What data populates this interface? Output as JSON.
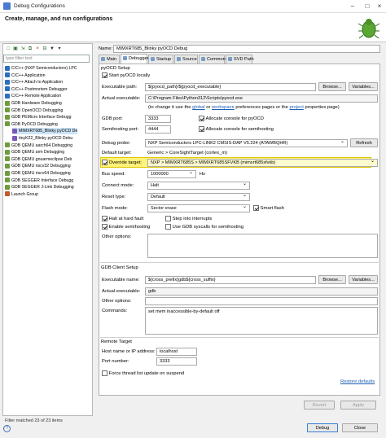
{
  "window": {
    "title": "Debug Configurations"
  },
  "banner": {
    "heading": "Create, manage, and run configurations"
  },
  "left": {
    "filter_placeholder": "type filter text",
    "tree": [
      {
        "label": "C/C++ (NXP Semiconductors) LPC",
        "level": 0,
        "color": "#2a6fbf"
      },
      {
        "label": "C/C++ Application",
        "level": 0,
        "color": "#2a6fbf"
      },
      {
        "label": "C/C++ Attach to Application",
        "level": 0,
        "color": "#2a6fbf"
      },
      {
        "label": "C/C++ Postmortem Debugger",
        "level": 0,
        "color": "#2a6fbf"
      },
      {
        "label": "C/C++ Remote Application",
        "level": 0,
        "color": "#2a6fbf"
      },
      {
        "label": "GDB Hardware Debugging",
        "level": 0,
        "color": "#6d9c3c"
      },
      {
        "label": "GDB OpenOCD Debugging",
        "level": 0,
        "color": "#6d9c3c"
      },
      {
        "label": "GDB PEMicro Interface Debugg",
        "level": 0,
        "color": "#6d9c3c"
      },
      {
        "label": "GDB PyOCD Debugging",
        "level": 0,
        "color": "#6d9c3c"
      },
      {
        "label": "MIMXRT685_Blinky pyOCD De",
        "level": 1,
        "color": "#7a58b8",
        "selected": true
      },
      {
        "label": "tinyK22_Blinky pyOCD Debu",
        "level": 1,
        "color": "#7a58b8"
      },
      {
        "label": "GDB QEMU aarch64 Debugging",
        "level": 0,
        "color": "#6d9c3c"
      },
      {
        "label": "GDB QEMU arm Debugging",
        "level": 0,
        "color": "#6d9c3c"
      },
      {
        "label": "GDB QEMU gnuarmeclipse Deb",
        "level": 0,
        "color": "#6d9c3c"
      },
      {
        "label": "GDB QEMU riscv32 Debugging",
        "level": 0,
        "color": "#6d9c3c"
      },
      {
        "label": "GDB QEMU riscv64 Debugging",
        "level": 0,
        "color": "#6d9c3c"
      },
      {
        "label": "GDB SEGGER Interface Debugg",
        "level": 0,
        "color": "#6d9c3c"
      },
      {
        "label": "GDB SEGGER J-Link Debugging",
        "level": 0,
        "color": "#6d9c3c"
      },
      {
        "label": "Launch Group",
        "level": 0,
        "color": "#c05a2a"
      }
    ],
    "footer": "Filter matched 23 of 23 items"
  },
  "config": {
    "name_label": "Name:",
    "name_value": "MIMXRT685_Blinky pyOCD Debug",
    "tabs": [
      "Main",
      "Debugger",
      "Startup",
      "Source",
      "Common",
      "SVD Path"
    ],
    "active_tab": 1
  },
  "pyocd": {
    "group": "pyOCD Setup",
    "start_locally": "Start pyOCD locally",
    "exe_label": "Executable path:",
    "exe_value": "${pyocd_path}/${pyocd_executable}",
    "actual_exe_label": "Actual executable:",
    "actual_exe_value": "C:\\Program Files\\Python312\\Scripts\\pyocd.exe",
    "change_note_pre": "(to change it use the",
    "global": "global",
    "or": "or",
    "workspace": "workspace",
    "preferences_mid": "preferences pages or the",
    "project": "project",
    "properties_post": "properties page)",
    "gdb_port_label": "GDB port:",
    "gdb_port": "3333",
    "alloc_pyocd": "Allocate console for pyOCD",
    "semi_port_label": "Semihosting port:",
    "semi_port": "4444",
    "alloc_semi": "Allocate console for semihosting",
    "probe_label": "Debug probe:",
    "probe_value": "NXP Semiconductors LPC-LINK2 CMSIS-DAP V5.224 (ATAWBQHR)",
    "refresh": "Refresh",
    "default_target_label": "Default target:",
    "default_target_value": "Generic > CoreSightTarget (cortex_m)",
    "override_label": "Override target:",
    "override_value": "NXP > MIMXRT685S > MIMXRT685SFVKB (mimxrt685sfvkb)",
    "bus_speed_label": "Bus speed:",
    "bus_speed_value": "1000000",
    "hz": "Hz",
    "connect_label": "Connect mode:",
    "connect_value": "Halt",
    "reset_label": "Reset type:",
    "reset_value": "Default",
    "flash_label": "Flash mode:",
    "flash_value": "Sector erase",
    "smart_flash": "Smart flash",
    "halt_fault": "Halt at hard fault",
    "step_irq": "Step into interrupts",
    "enable_semi": "Enable semihosting",
    "gdb_syscalls": "Use GDB syscalls for semihosting",
    "other_label": "Other options:",
    "browse": "Browse...",
    "variables": "Variables..."
  },
  "gdb": {
    "group": "GDB Client Setup",
    "exe_label": "Executable name:",
    "exe_value": "${cross_prefix}gdb${cross_suffix}",
    "actual_label": "Actual executable:",
    "actual_value": "gdb",
    "other_label": "Other options:",
    "commands_label": "Commands:",
    "commands_value": "set mem inaccessible-by-default off"
  },
  "remote": {
    "group": "Remote Target",
    "host_label": "Host name or IP address:",
    "host_value": "localhost",
    "port_label": "Port number:",
    "port_value": "3333",
    "force_thread": "Force thread list update on suspend",
    "restore": "Restore defaults"
  },
  "bottom": {
    "revert": "Revert",
    "apply": "Apply",
    "debug": "Debug",
    "close": "Close"
  }
}
